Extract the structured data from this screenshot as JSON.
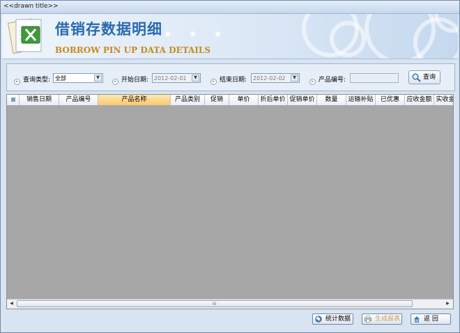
{
  "window": {
    "title": "<<drawn title>>"
  },
  "banner": {
    "title_cn": "借销存数据明细",
    "title_en": "BORROW PIN UP DATA DETAILS",
    "stars": "★ ★ ★"
  },
  "filters": {
    "query_type": {
      "label": "查询类型:",
      "value": "全部"
    },
    "start_date": {
      "label": "开始日期:",
      "value": "2012-02-01"
    },
    "end_date": {
      "label": "结束日期:",
      "value": "2012-02-02"
    },
    "product_no": {
      "label": "产品编号:",
      "value": ""
    },
    "query_button": "查询"
  },
  "grid": {
    "row_header_icon": "grid-icon",
    "columns": [
      "销售日期",
      "产品编号",
      "产品名称",
      "产品类别",
      "促销",
      "单价",
      "折后单价",
      "促销单价",
      "数量",
      "运输补贴",
      "已优惠",
      "应收金额",
      "实收金额"
    ],
    "scroll_grip": "III"
  },
  "footer": {
    "stats_button": "统计数据",
    "report_button": "生成报表",
    "back_button": "返  回"
  },
  "colors": {
    "accent": "#2a6ab0",
    "subtitle": "#c98a1a",
    "active_column": "#fbc76b"
  }
}
